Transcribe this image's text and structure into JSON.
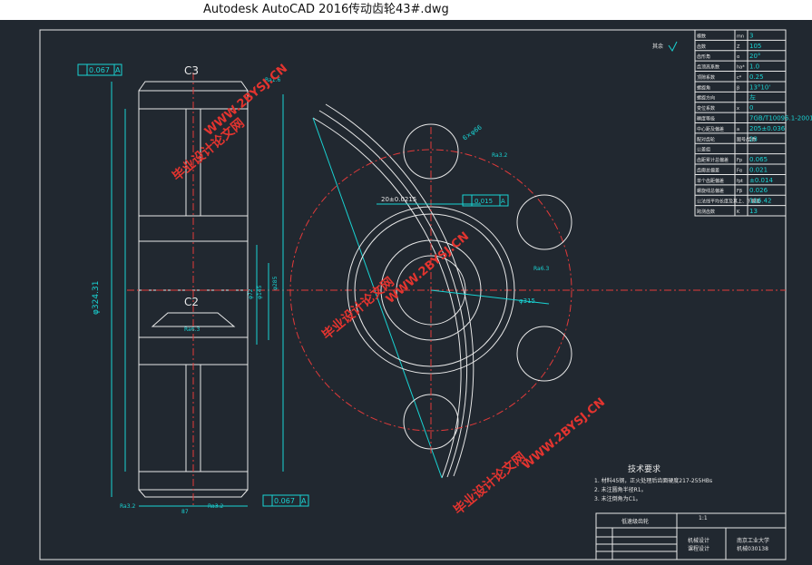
{
  "window": {
    "app_title": "Autodesk AutoCAD 2016",
    "file_title": "传动齿轮43#.dwg"
  },
  "colors": {
    "background": "#212830",
    "outline": "#e8e8e8",
    "dimension": "#19d3d3",
    "centerline": "#e23a3a",
    "watermark": "#e3342f"
  },
  "gear_view": {
    "chamfer_top": "C3",
    "chamfer_mid": "C2",
    "runout_top": "0.067",
    "runout_bottom": "0.067",
    "datum": "A",
    "rough_top": "Ra1.6",
    "rough_mid": "Ra6.3",
    "rough_bl": "Ra3.2",
    "rough_br": "Ra3.2",
    "dia_outer": "φ324.31",
    "dia_mid": "φ145",
    "dia_right": "φ285",
    "dia_small": "φ72",
    "width": "87"
  },
  "face_view": {
    "hole_label": "6×φ66",
    "rough_a": "Ra3.2",
    "rough_b": "Ra6.3",
    "keyway": "20±0.0215",
    "sym_tol": "0.015",
    "sym_datum": "A",
    "dia_pitch": "φ315"
  },
  "else_rough": "其余",
  "params": [
    {
      "name": "模数",
      "sym": "mn",
      "val": "3"
    },
    {
      "name": "齿数",
      "sym": "Z",
      "val": "105"
    },
    {
      "name": "齿形角",
      "sym": "α",
      "val": "20°"
    },
    {
      "name": "齿顶高系数",
      "sym": "ha*",
      "val": "1.0"
    },
    {
      "name": "顶隙系数",
      "sym": "c*",
      "val": "0.25"
    },
    {
      "name": "螺旋角",
      "sym": "β",
      "val": "13°10'"
    },
    {
      "name": "螺旋方向",
      "sym": "",
      "val": "左"
    },
    {
      "name": "变位系数",
      "sym": "x",
      "val": "0"
    },
    {
      "name": "精度等级",
      "sym": "",
      "val": "7GB/T10095.1-2001"
    },
    {
      "name": "中心距及偏差",
      "sym": "a",
      "val": "205±0.036"
    },
    {
      "name": "配对齿轮",
      "sym": "图号/齿数",
      "val": "23"
    },
    {
      "name": "公差组",
      "sym": "",
      "val": ""
    },
    {
      "name": "齿距累计总偏差",
      "sym": "Fp",
      "val": "0.065"
    },
    {
      "name": "齿廓总偏差",
      "sym": "Fα",
      "val": "0.021"
    },
    {
      "name": "单个齿距偏差",
      "sym": "fpt",
      "val": "±0.014"
    },
    {
      "name": "螺旋线总偏差",
      "sym": "Fβ",
      "val": "0.026"
    },
    {
      "name": "公法线平均长度及其上、下偏差",
      "sym": "",
      "val": "116.42"
    },
    {
      "name": "跨测齿数",
      "sym": "K",
      "val": "13"
    }
  ],
  "tech": {
    "title": "技术要求",
    "lines": [
      "1. 材料45钢，正火处理后齿面硬度217-255HBs",
      "2. 未注圆角半径R1。",
      "3. 未注倒角为C1。"
    ]
  },
  "titleblock": {
    "part_name": "低速级齿轮",
    "scale": "1:1",
    "designer": "机械设计",
    "course": "课程设计",
    "school": "南京工业大学",
    "class": "机械030138"
  },
  "watermarks": {
    "site": "WWW.2BYSJ.CN",
    "cn": "毕业设计论文网"
  }
}
